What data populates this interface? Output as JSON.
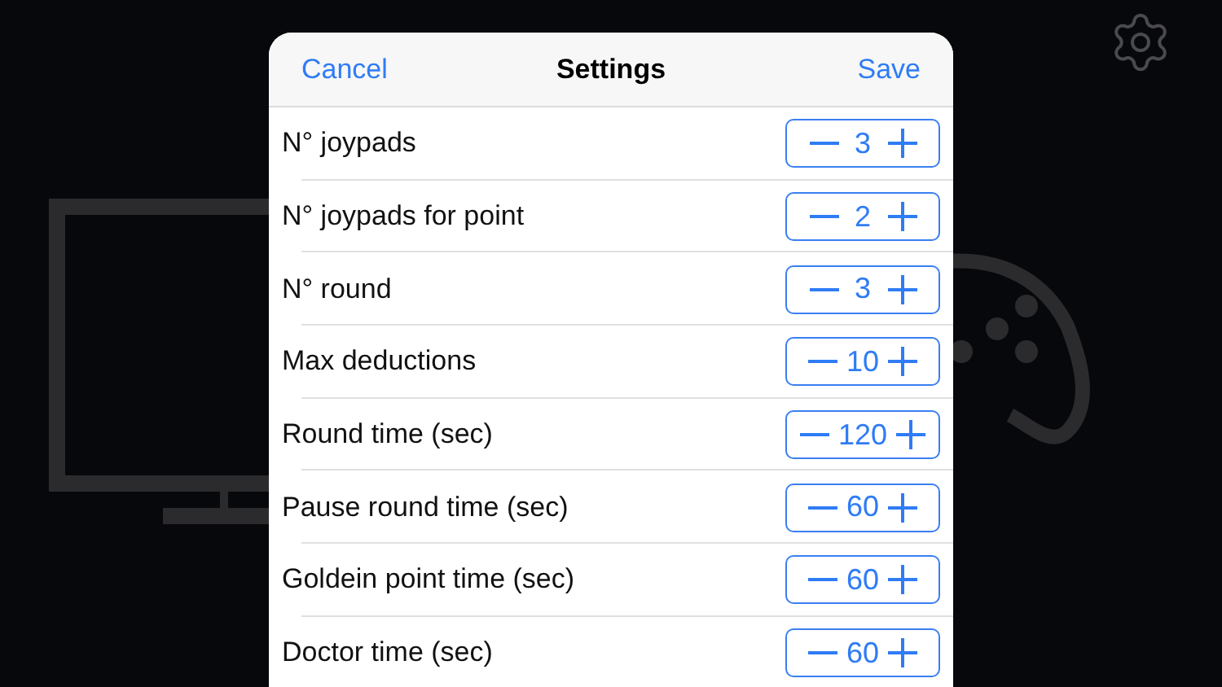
{
  "dialog": {
    "cancel": "Cancel",
    "title": "Settings",
    "save": "Save",
    "rows": [
      {
        "label": "N° joypads",
        "value": "3"
      },
      {
        "label": "N° joypads for point",
        "value": "2"
      },
      {
        "label": "N° round",
        "value": "3"
      },
      {
        "label": "Max deductions",
        "value": "10"
      },
      {
        "label": "Round time (sec)",
        "value": "120"
      },
      {
        "label": "Pause round time (sec)",
        "value": "60"
      },
      {
        "label": "Goldein point time (sec)",
        "value": "60"
      },
      {
        "label": "Doctor time (sec)",
        "value": "60"
      }
    ]
  }
}
